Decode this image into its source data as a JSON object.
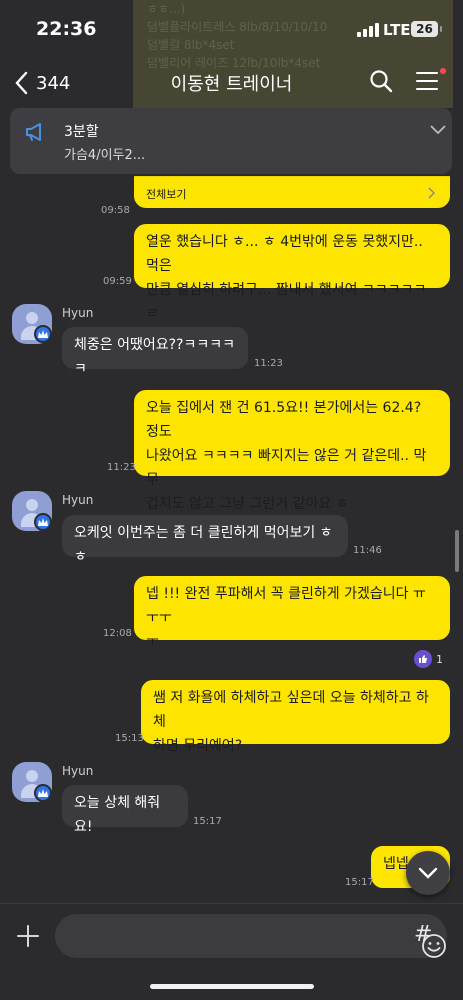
{
  "status_bar": {
    "time": "22:36",
    "network": "LTE",
    "battery": "26"
  },
  "header": {
    "back_count": "344",
    "title": "이동현 트레이너"
  },
  "faded_overlay": [
    "ㅎㅎ...)",
    "덤벨플라이트레스 8lb/8/10/10/10",
    "덤벨컬 8lb*4set",
    "덤벨리어 레이즈 12lb/10lb*4set"
  ],
  "notice": {
    "line1": "3분할",
    "line2": "가슴4/이두2..."
  },
  "full_view": {
    "label": "전체보기",
    "time": "09:58"
  },
  "messages": [
    {
      "side": "mine",
      "text": "열운 했습니다 ㅎ... ㅎ 4번밖에 운동 못했지만.. 먹은\n만큼 열심히 하려구... 짬내서 했서여 ㅋㅋㅋㅋㅋㄹ",
      "time": "09:59"
    },
    {
      "side": "theirs",
      "sender": "Hyun",
      "text": "체중은 어땠어요??ㅋㅋㅋㅋㅋ",
      "time": "11:23"
    },
    {
      "side": "mine",
      "text": "오늘 집에서 잰 건 61.5요!! 본가에서는 62.4? 정도\n나왔어요 ㅋㅋㅋㅋ 빠지지는 않은 거 같은데.. 막 무\n겁지도 않고 그냥 그런거 같아요 ㅎ",
      "time": "11:23"
    },
    {
      "side": "theirs",
      "sender": "Hyun",
      "text": "오케잇 이번주는 좀 더 클린하게 먹어보기 ㅎㅎ",
      "time": "11:46"
    },
    {
      "side": "mine",
      "text": "넵 !!! 완전 푸파해서 꼭 클린하게 가겠습니다 ㅠㅜㅜ\nㅜ",
      "time": "12:08"
    },
    {
      "side": "mine",
      "text": "쌤 저 화욜에 하체하고 싶은데 오늘 하체하고 하체\n하면 무리예여?",
      "time": "15:13"
    },
    {
      "side": "theirs",
      "sender": "Hyun",
      "text": "오늘 상체 해줘요!",
      "time": "15:17"
    },
    {
      "side": "mine",
      "text": "넵넵",
      "time": "15:17"
    }
  ],
  "reaction": {
    "count": "1"
  },
  "icons": [
    "back-chevron-icon",
    "search-icon",
    "menu-icon",
    "megaphone-icon",
    "chevron-down-icon",
    "chevron-right-icon",
    "thumbs-up-icon",
    "plus-icon",
    "emoji-icon",
    "hash-icon"
  ],
  "colors": {
    "background": "#2b2b2e",
    "my_bubble": "#fee500",
    "their_bubble": "#3b3b3f",
    "avatar": "#8f9fd4",
    "badge": "#2f74e8"
  }
}
